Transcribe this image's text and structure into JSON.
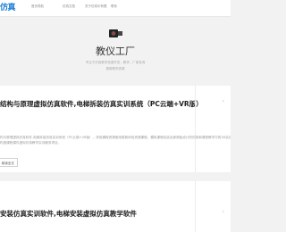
{
  "header": {
    "logo_text": "仿真",
    "nav": [
      "首页导航",
      "仿真文档",
      "关于仿真中有限",
      "联系"
    ]
  },
  "hero": {
    "logo_icon": "site-logo-icon",
    "title": "教仪工厂",
    "desc_line1": "专注于仿真教学资源开发，教学、厂家查询",
    "desc_line2": "更新教学资源"
  },
  "posts": [
    {
      "title": "结构与原理虚拟仿真软件,电梯拆装仿真实训系统（PC云端+VR版）",
      "excerpt_line1": "构与原理虚拟仿真软件,电梯拆装仿真实训系统（PC云端+VR版），体验课程资源使用更新体验资源课程，模拟课程包括全部原始设计的仿真和课堂教学中的3D实训仿真题目",
      "excerpt_line2": "构造课程课件虚拟仿真教学实训服务项目，",
      "read_more": "阅读全文",
      "side_mark": "›"
    },
    {
      "title": "安装仿真实训软件,电梯安装虚拟仿真教学软件",
      "side_mark": "›"
    }
  ],
  "colors": {
    "brand": "#1c7ed6",
    "background": "#f2f2f2",
    "card": "#ffffff"
  }
}
